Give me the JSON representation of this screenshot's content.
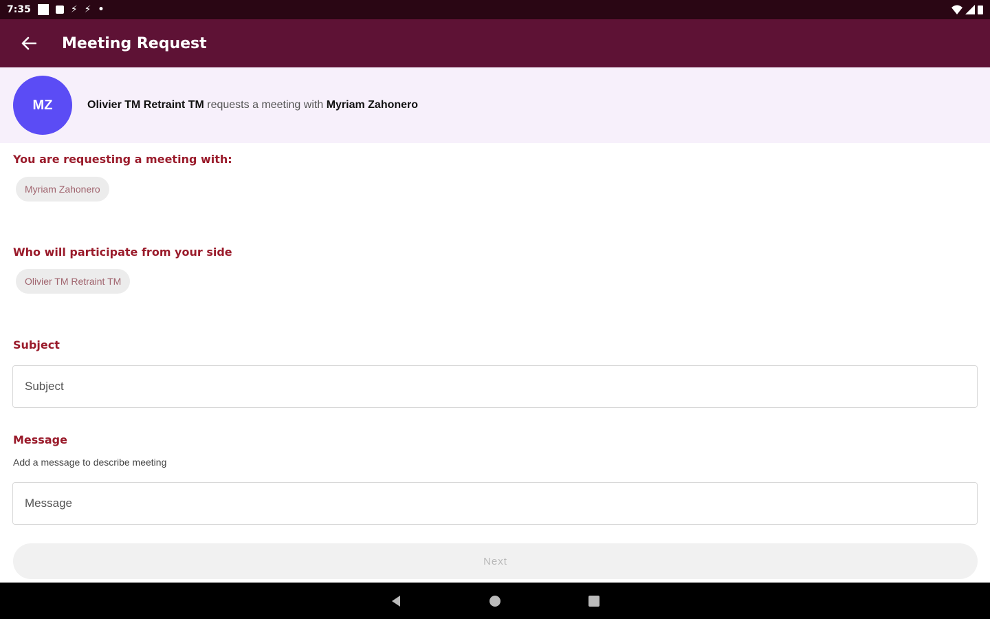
{
  "status_bar": {
    "time": "7:35"
  },
  "app_bar": {
    "title": "Meeting Request"
  },
  "header": {
    "avatar_initials": "MZ",
    "avatar_color": "#5b4cf5",
    "requester": "Olivier TM Retraint TM",
    "connector": "requests a meeting with",
    "recipient": "Myriam Zahonero"
  },
  "form": {
    "requesting_label": "You are requesting a meeting with:",
    "requesting_chip": "Myriam Zahonero",
    "participants_label": "Who will participate from your side",
    "participants_chip": "Olivier TM Retraint TM",
    "subject_label": "Subject",
    "subject_placeholder": "Subject",
    "message_label": "Message",
    "message_hint": "Add a message to describe meeting",
    "message_placeholder": "Message",
    "next_label": "Next"
  },
  "colors": {
    "app_bar": "#5e1235",
    "accent": "#9a1b2b",
    "header_bg": "#f7f0fb"
  }
}
